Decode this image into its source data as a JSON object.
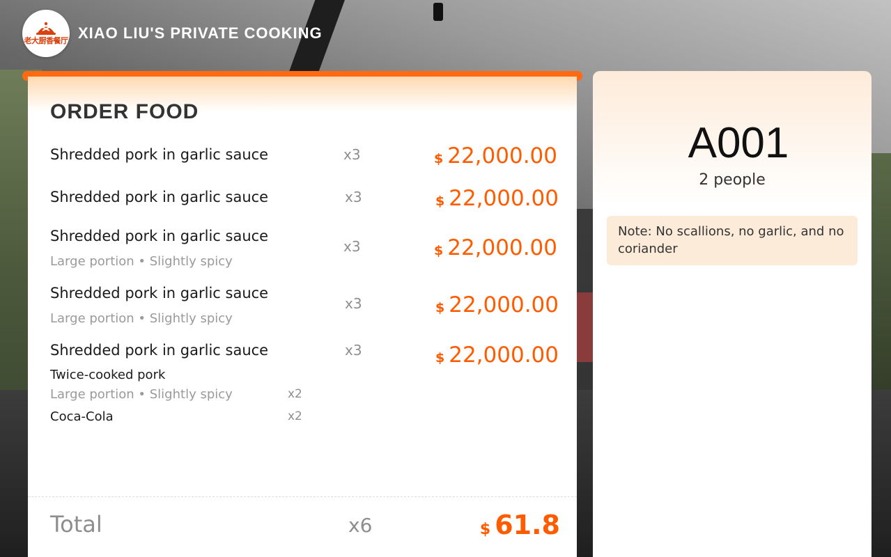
{
  "header": {
    "logo_text": "老大厨香餐厅",
    "brand": "XIAO LIU'S PRIVATE COOKING"
  },
  "order": {
    "title": "ORDER FOOD",
    "items": [
      {
        "name": "Shredded pork in garlic sauce",
        "qty": "x3",
        "currency": "$",
        "price": "22,000.00"
      },
      {
        "name": "Shredded pork in garlic sauce",
        "qty": "x3",
        "currency": "$",
        "price": "22,000.00"
      },
      {
        "name": "Shredded pork in garlic sauce",
        "options": "Large portion • Slightly spicy",
        "qty": "x3",
        "currency": "$",
        "price": "22,000.00"
      },
      {
        "name": "Shredded pork in garlic sauce",
        "options": "Large portion • Slightly spicy",
        "qty": "x3",
        "currency": "$",
        "price": "22,000.00"
      },
      {
        "name": "Shredded pork in garlic sauce",
        "qty": "x3",
        "currency": "$",
        "price": "22,000.00"
      }
    ],
    "sub_items": [
      {
        "name": "Twice-cooked pork",
        "qty": ""
      },
      {
        "name": "Large portion • Slightly spicy",
        "qty": "x2"
      },
      {
        "name": "Coca-Cola",
        "qty": "x2"
      }
    ],
    "total": {
      "label": "Total",
      "qty": "x6",
      "currency": "$",
      "amount": "61.8"
    }
  },
  "table": {
    "code": "A001",
    "people": "2 people",
    "note": "Note: No scallions, no garlic, and no coriander"
  },
  "colors": {
    "accent": "#ff5c00",
    "accent_bar": "#ff6a12",
    "panel_tint": "#fdebd9"
  }
}
